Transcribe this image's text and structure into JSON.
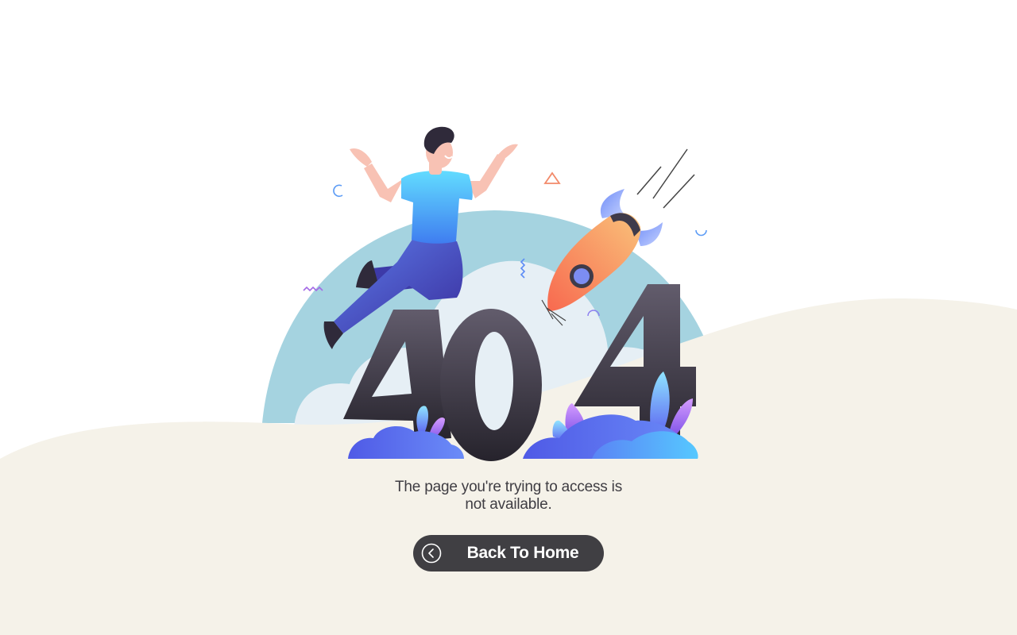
{
  "illustration": {
    "error_code": "404",
    "colors": {
      "page_background": "#ffffff",
      "ground": "#f5f2e9",
      "dome": "#a5d3e0",
      "cloud": "#e6eff5",
      "digits": "#35323d",
      "shirt": "#4aa0f5",
      "pants": "#4c46c8",
      "rocket": "#f9905f",
      "foliage": "#5a6df0"
    }
  },
  "message": {
    "line1": "The page you're trying to access is",
    "line2": "not available."
  },
  "button": {
    "label": "Back To Home",
    "icon": "chevron-left-circle-icon",
    "background": "#403f43"
  }
}
